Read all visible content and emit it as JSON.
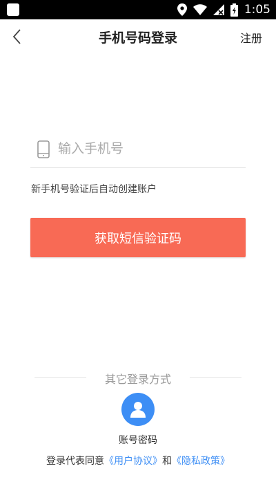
{
  "status_bar": {
    "time": "1:05"
  },
  "header": {
    "title": "手机号码登录",
    "register_label": "注册"
  },
  "form": {
    "phone_placeholder": "输入手机号",
    "hint": "新手机号验证后自动创建账户",
    "sms_button_label": "获取短信验证码"
  },
  "other_login": {
    "label": "其它登录方式",
    "account_label": "账号密码"
  },
  "agreement": {
    "prefix": "登录代表同意",
    "user_agreement": "《用户协议》",
    "conjunction": "和",
    "privacy_policy": "《隐私政策》"
  },
  "colors": {
    "primary_button": "#f86a55",
    "link": "#3d8ef5",
    "avatar": "#3d8ef5"
  },
  "icons": {
    "back": "chevron-left-icon",
    "phone": "phone-icon",
    "account": "user-icon"
  }
}
